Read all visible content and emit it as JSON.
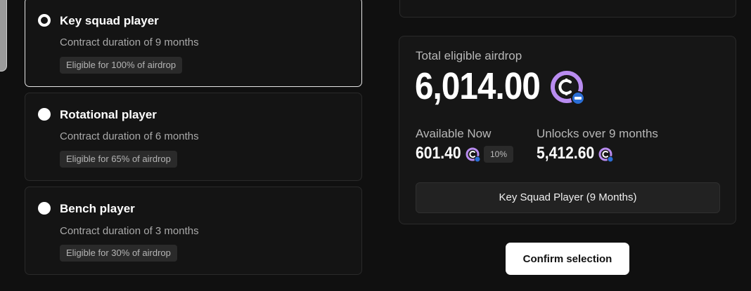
{
  "options": [
    {
      "title": "Key squad player",
      "duration": "Contract duration of 9 months",
      "badge": "Eligible for 100% of airdrop",
      "selected": true
    },
    {
      "title": "Rotational player",
      "duration": "Contract duration of 6 months",
      "badge": "Eligible for 65% of airdrop",
      "selected": false
    },
    {
      "title": "Bench player",
      "duration": "Contract duration of 3 months",
      "badge": "Eligible for 30% of airdrop",
      "selected": false
    }
  ],
  "summary": {
    "total_label": "Total eligible airdrop",
    "total_amount": "6,014.00",
    "available_label": "Available Now",
    "available_amount": "601.40",
    "available_percent": "10%",
    "unlock_label": "Unlocks over 9 months",
    "unlock_amount": "5,412.60",
    "plan_label": "Key Squad Player (9 Months)"
  },
  "confirm_label": "Confirm selection",
  "icons": {
    "token": "token-coin-icon"
  },
  "colors": {
    "accent": "#b98cf0",
    "badge_blue": "#2a6ed6",
    "background": "#101010"
  }
}
